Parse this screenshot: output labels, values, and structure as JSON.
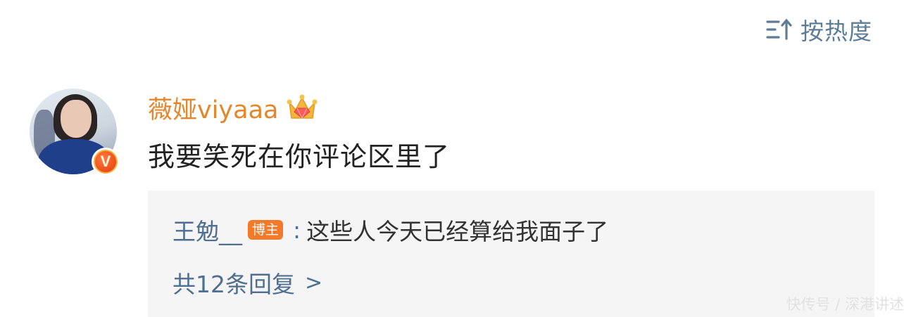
{
  "sort": {
    "label": "按热度",
    "icon": "sort-icon"
  },
  "comment": {
    "username": "薇娅viyaaa",
    "text": "我要笑死在你评论区里了",
    "verified_badge": "V",
    "crown_icon": "crown-icon"
  },
  "reply": {
    "username": "王勉__",
    "author_badge": "博主",
    "colon": ":",
    "text": "这些人今天已经算给我面子了",
    "more_label": "共12条回复",
    "chevron": ">"
  },
  "watermark": "快传号 / 深港讲述",
  "colors": {
    "username": "#e5862a",
    "link": "#4f6f91",
    "badge": "#f47a2a",
    "sort": "#5d7c97"
  }
}
